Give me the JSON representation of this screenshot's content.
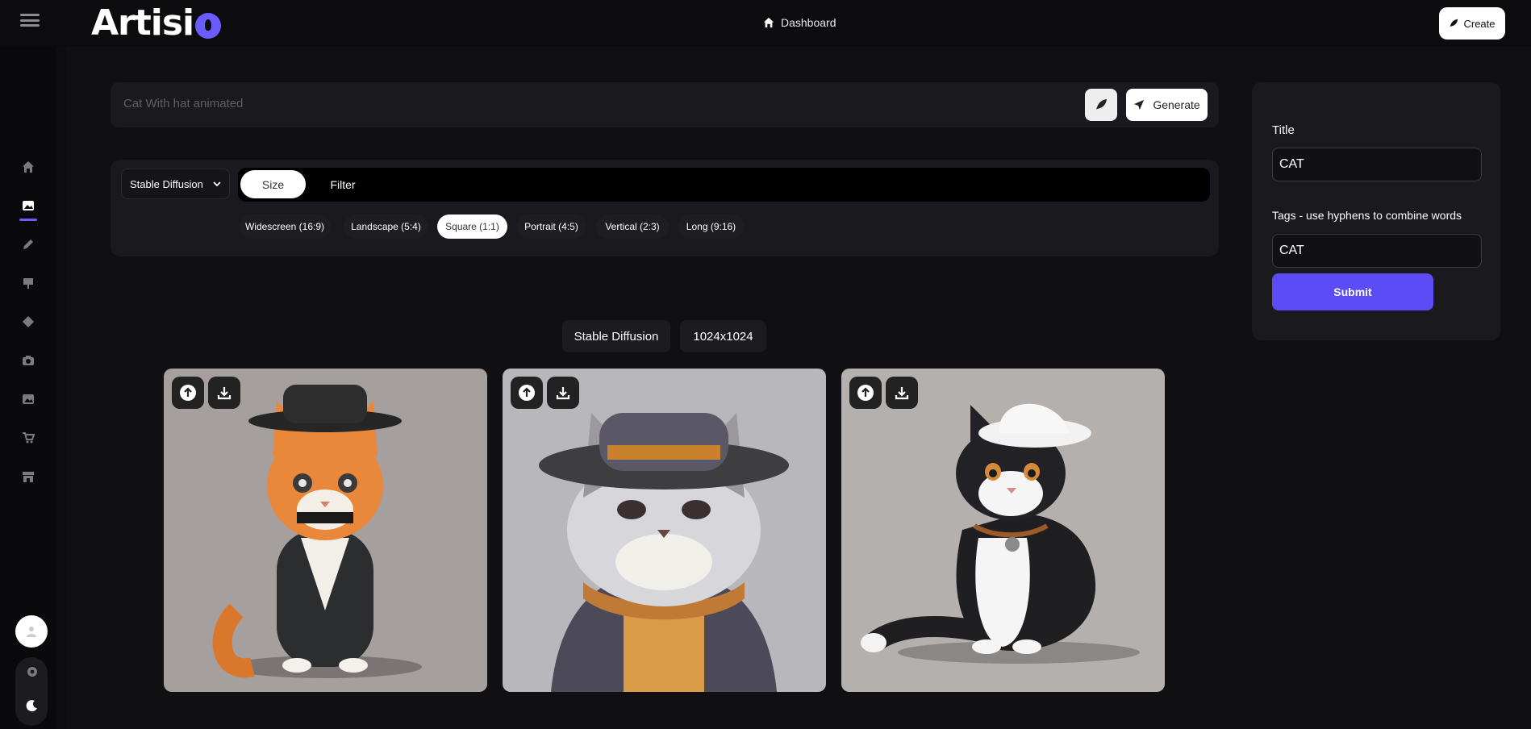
{
  "app": {
    "logo_text": "Artisi",
    "brand_color": "#6a5cff"
  },
  "header": {
    "dashboard_label": "Dashboard",
    "create_label": "Create"
  },
  "sidebar": {
    "items": [
      {
        "icon": "home-icon"
      },
      {
        "icon": "image-icon",
        "active": true
      },
      {
        "icon": "pencil-icon"
      },
      {
        "icon": "easel-icon"
      },
      {
        "icon": "diamond-icon"
      },
      {
        "icon": "camera-icon"
      },
      {
        "icon": "gallery-icon"
      },
      {
        "icon": "cart-icon"
      },
      {
        "icon": "store-icon"
      }
    ],
    "bottom": [
      "avatar",
      "gear-icon",
      "moon-icon"
    ]
  },
  "prompt": {
    "value": "",
    "placeholder": "Cat With hat animated",
    "generate_label": "Generate"
  },
  "options": {
    "model": "Stable Diffusion",
    "tabs": [
      "Size",
      "Filter"
    ],
    "active_tab": "Size",
    "sizes": [
      "Widescreen (16:9)",
      "Landscape (5:4)",
      "Square (1:1)",
      "Portrait (4:5)",
      "Vertical (2:3)",
      "Long (9:16)"
    ],
    "selected_size": "Square (1:1)"
  },
  "result": {
    "model": "Stable Diffusion",
    "resolution": "1024x1024",
    "images": [
      {
        "subject": "orange tabby cat with black hat"
      },
      {
        "subject": "grey cat with brimmed hat"
      },
      {
        "subject": "black and white cat with white bucket hat"
      }
    ]
  },
  "form": {
    "title_label": "Title",
    "title_value": "CAT",
    "tags_label": "Tags - use hyphens to combine words",
    "tags_value": "CAT",
    "submit_label": "Submit"
  }
}
